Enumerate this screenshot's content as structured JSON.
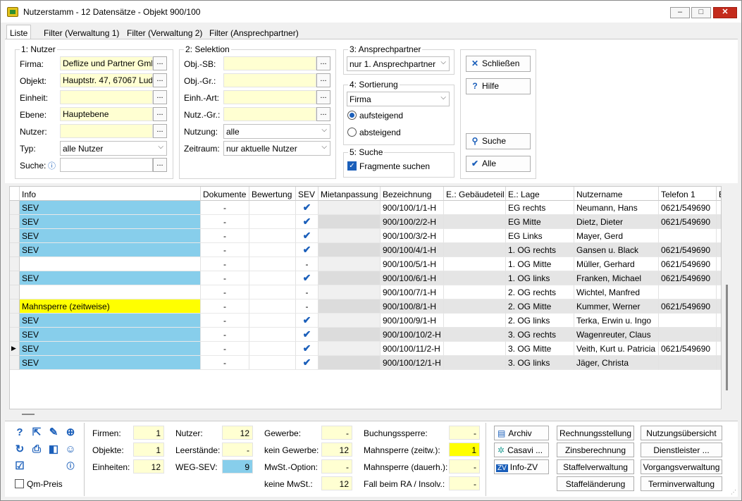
{
  "window": {
    "title": "Nutzerstamm - 12 Datensätze - Objekt 900/100",
    "min": "–",
    "max": "□",
    "close": "✕"
  },
  "tabs": [
    "Liste",
    "Filter (Verwaltung 1)",
    "Filter (Verwaltung 2)",
    "Filter (Ansprechpartner)"
  ],
  "nutzer": {
    "legend": "1: Nutzer",
    "firma_label": "Firma:",
    "firma_value": "Deflize und Partner GmbH",
    "objekt_label": "Objekt:",
    "objekt_value": "Hauptstr. 47, 67067 Ludwigshafen",
    "einheit_label": "Einheit:",
    "einheit_value": "",
    "ebene_label": "Ebene:",
    "ebene_value": "Hauptebene",
    "nutzer_label": "Nutzer:",
    "nutzer_value": "",
    "typ_label": "Typ:",
    "typ_value": "alle Nutzer",
    "suche_label": "Suche:",
    "suche_value": ""
  },
  "selektion": {
    "legend": "2: Selektion",
    "objsb_label": "Obj.-SB:",
    "objgr_label": "Obj.-Gr.:",
    "einhart_label": "Einh.-Art:",
    "nutzgr_label": "Nutz.-Gr.:",
    "nutzung_label": "Nutzung:",
    "nutzung_value": "alle",
    "zeitraum_label": "Zeitraum:",
    "zeitraum_value": "nur aktuelle Nutzer"
  },
  "ansprechpartner": {
    "legend": "3: Ansprechpartner",
    "value": "nur 1. Ansprechpartner"
  },
  "sortierung": {
    "legend": "4: Sortierung",
    "value": "Firma",
    "asc_label": "aufsteigend",
    "desc_label": "absteigend",
    "selected": "aufsteigend"
  },
  "suche": {
    "legend": "5: Suche",
    "fragmente_label": "Fragmente suchen",
    "fragmente_checked": true
  },
  "actions": {
    "close": "Schließen",
    "help": "Hilfe",
    "search": "Suche",
    "all": "Alle"
  },
  "grid": {
    "columns": [
      "Info",
      "Dokumente",
      "Bewertung",
      "SEV",
      "Mietanpassung",
      "Bezeichnung",
      "E.: Gebäudeteil",
      "E.: Lage",
      "Nutzername",
      "Telefon 1",
      "E"
    ],
    "rows": [
      {
        "info": "SEV",
        "dok": "-",
        "sev": "check",
        "bez": "900/100/1/1-H",
        "lage": "EG rechts",
        "name": "Neumann, Hans",
        "tel": "0621/549690"
      },
      {
        "info": "SEV",
        "dok": "-",
        "sev": "check",
        "bez": "900/100/2/2-H",
        "lage": "EG Mitte",
        "name": "Dietz, Dieter",
        "tel": "0621/549690"
      },
      {
        "info": "SEV",
        "dok": "-",
        "sev": "check",
        "bez": "900/100/3/2-H",
        "lage": "EG Links",
        "name": "Mayer, Gerd",
        "tel": ""
      },
      {
        "info": "SEV",
        "dok": "-",
        "sev": "check",
        "bez": "900/100/4/1-H",
        "lage": "1. OG rechts",
        "name": "Gansen u. Black",
        "tel": "0621/549690"
      },
      {
        "info": "",
        "dok": "-",
        "sev": "-",
        "bez": "900/100/5/1-H",
        "lage": "1. OG Mitte",
        "name": "Müller, Gerhard",
        "tel": "0621/549690"
      },
      {
        "info": "SEV",
        "dok": "-",
        "sev": "check",
        "bez": "900/100/6/1-H",
        "lage": "1. OG links",
        "name": "Franken, Michael",
        "tel": "0621/549690"
      },
      {
        "info": "",
        "dok": "-",
        "sev": "-",
        "bez": "900/100/7/1-H",
        "lage": "2. OG rechts",
        "name": "Wichtel, Manfred",
        "tel": ""
      },
      {
        "info": "Mahnsperre (zeitweise)",
        "dok": "-",
        "sev": "-",
        "bez": "900/100/8/1-H",
        "lage": "2. OG Mitte",
        "name": "Kummer, Werner",
        "tel": "0621/549690"
      },
      {
        "info": "SEV",
        "dok": "-",
        "sev": "check",
        "bez": "900/100/9/1-H",
        "lage": "2. OG links",
        "name": "Terka, Erwin u. Ingo",
        "tel": ""
      },
      {
        "info": "SEV",
        "dok": "-",
        "sev": "check",
        "bez": "900/100/10/2-H",
        "lage": "3. OG rechts",
        "name": "Wagenreuter, Claus",
        "tel": ""
      },
      {
        "info": "SEV",
        "dok": "-",
        "sev": "check",
        "bez": "900/100/11/2-H",
        "lage": "3. OG Mitte",
        "name": "Veith, Kurt u. Patricia",
        "tel": "0621/549690"
      },
      {
        "info": "SEV",
        "dok": "-",
        "sev": "check",
        "bez": "900/100/12/1-H",
        "lage": "3. OG links",
        "name": "Jäger, Christa",
        "tel": ""
      }
    ],
    "current_row_marker": "▶",
    "colors": {
      "sev": "#87ceeb",
      "mahnsperre": "#ffff00",
      "check": "#1b5fba"
    }
  },
  "stats": {
    "firmen_label": "Firmen:",
    "firmen": "1",
    "objekte_label": "Objekte:",
    "objekte": "1",
    "einheiten_label": "Einheiten:",
    "einheiten": "12",
    "nutzer_label": "Nutzer:",
    "nutzer": "12",
    "leerstaende_label": "Leerstände:",
    "leerstaende": "-",
    "wegsev_label": "WEG-SEV:",
    "wegsev": "9",
    "gewerbe_label": "Gewerbe:",
    "gewerbe": "-",
    "kein_gewerbe_label": "kein Gewerbe:",
    "kein_gewerbe": "12",
    "mwst_option_label": "MwSt.-Option:",
    "mwst_option": "-",
    "keine_mwst_label": "keine MwSt.:",
    "keine_mwst": "12",
    "buchungssperre_label": "Buchungssperre:",
    "buchungssperre": "-",
    "mahnsperre_zeitw_label": "Mahnsperre (zeitw.):",
    "mahnsperre_zeitw": "1",
    "mahnsperre_dauer_label": "Mahnsperre (dauerh.):",
    "mahnsperre_dauer": "-",
    "fall_ra_label": "Fall beim RA / Insolv.:",
    "fall_ra": "-"
  },
  "qm_preis_label": "Qm-Preis",
  "bottom_buttons": {
    "archiv": "Archiv",
    "casavi": "Casavi ...",
    "infozv": "Info-ZV",
    "zv_badge": "ZV",
    "rechnungsstellung": "Rechnungsstellung",
    "zinsberechnung": "Zinsberechnung",
    "staffelverwaltung": "Staffelverwaltung",
    "staffelaenderung": "Staffeländerung",
    "nutzungsuebersicht": "Nutzungsübersicht",
    "dienstleister": "Dienstleister ...",
    "vorgangsverwaltung": "Vorgangsverwaltung",
    "terminverwaltung": "Terminverwaltung"
  }
}
